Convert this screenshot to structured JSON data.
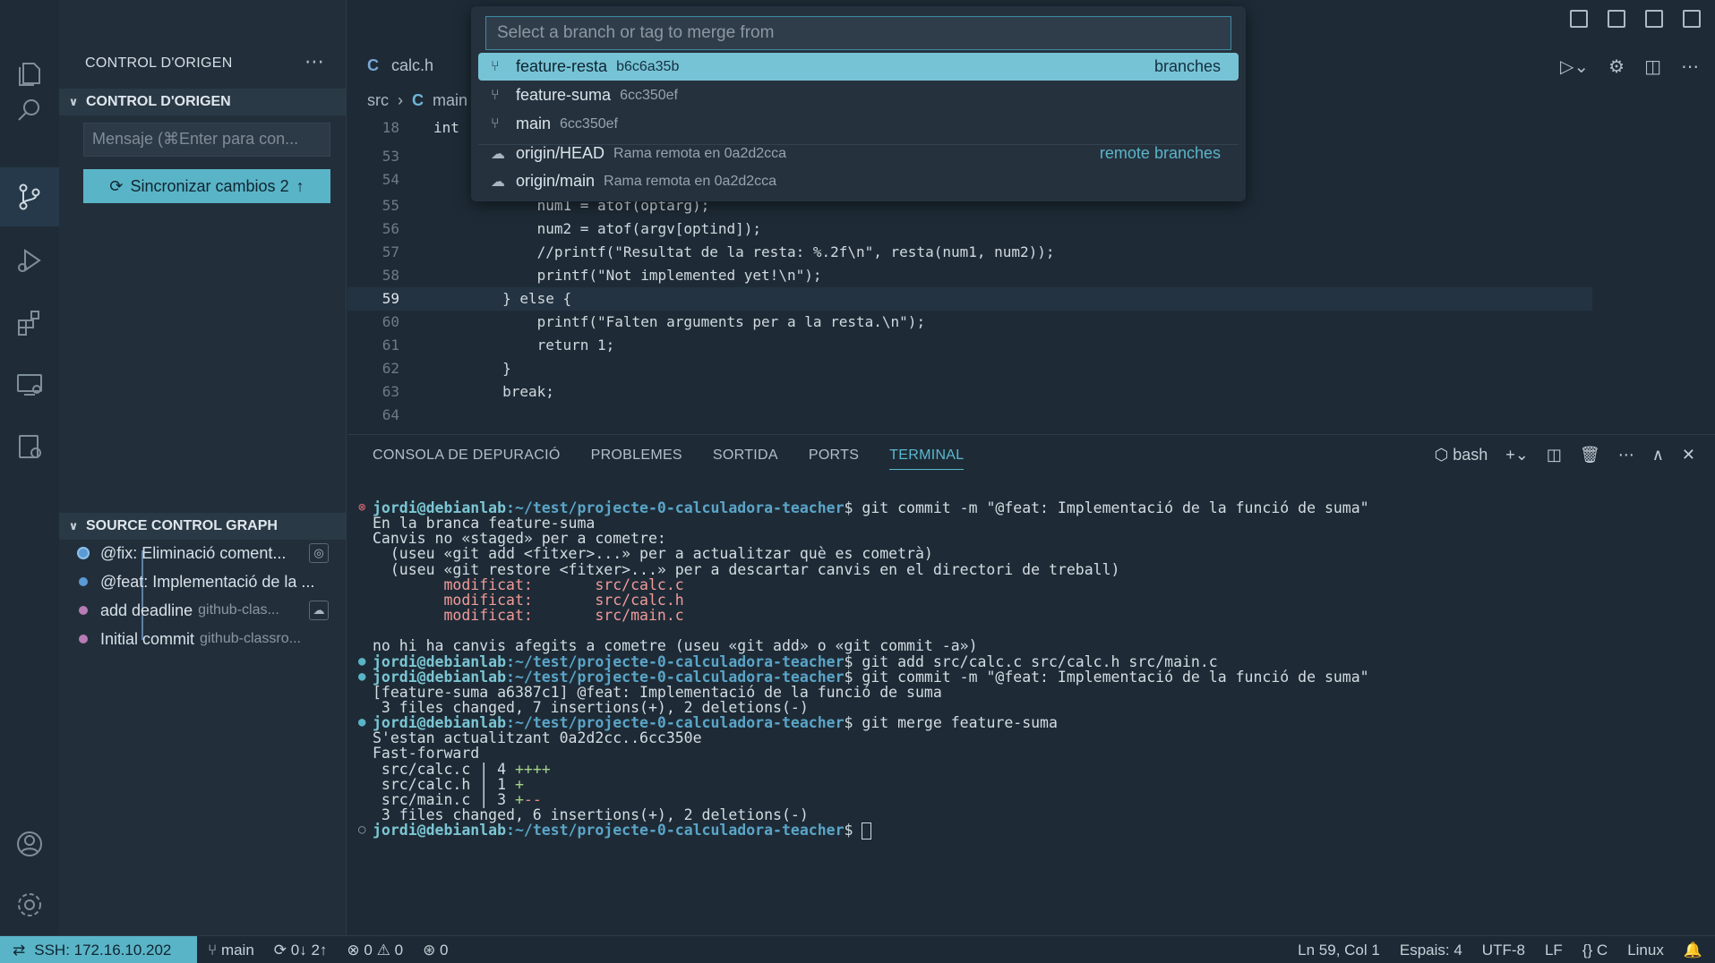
{
  "activity": [
    "explorer-icon",
    "search-icon",
    "source-control-icon",
    "run-debug-icon",
    "extensions-icon",
    "remote-explorer-icon",
    "testing-icon",
    "account-icon",
    "manage-gear-icon"
  ],
  "sidebar": {
    "title": "CONTROL D'ORIGEN",
    "section1": "CONTROL D'ORIGEN",
    "message_placeholder": "Mensaje (⌘Enter para con...",
    "sync_label": "Sincronizar cambios 2",
    "graph_title": "SOURCE CONTROL GRAPH",
    "graph": [
      {
        "label": "@fix: Eliminació coment...",
        "sub": "",
        "color": "#5a9bd6"
      },
      {
        "label": "@feat: Implementació de la ...",
        "sub": "",
        "color": "#5a9bd6"
      },
      {
        "label": "add deadline",
        "sub": "github-clas...",
        "color": "#b77bb5"
      },
      {
        "label": "Initial commit",
        "sub": "github-classro...",
        "color": "#b77bb5"
      }
    ]
  },
  "editor": {
    "tab": "calc.h",
    "tab_c": "C",
    "breadcrumb": [
      "src",
      "main"
    ],
    "lines": [
      {
        "n": "18",
        "code": "int"
      },
      {
        "n": "53",
        "code": ""
      },
      {
        "n": "54",
        "code": ""
      },
      {
        "n": "55",
        "code": "            num1 = atof(optarg);"
      },
      {
        "n": "56",
        "code": "            num2 = atof(argv[optind]);"
      },
      {
        "n": "57",
        "code": "            //printf(\"Resultat de la resta: %.2f\\n\", resta(num1, num2));"
      },
      {
        "n": "58",
        "code": "            printf(\"Not implemented yet!\\n\");"
      },
      {
        "n": "59",
        "code": "        } else {"
      },
      {
        "n": "60",
        "code": "            printf(\"Falten arguments per a la resta.\\n\");"
      },
      {
        "n": "61",
        "code": "            return 1;"
      },
      {
        "n": "62",
        "code": "        }"
      },
      {
        "n": "63",
        "code": "        break;"
      },
      {
        "n": "64",
        "code": ""
      }
    ]
  },
  "quickpick": {
    "placeholder": "Select a branch or tag to merge from",
    "items": [
      {
        "label": "feature-resta",
        "desc": "b6c6a35b",
        "group": "branches",
        "icon": "branch"
      },
      {
        "label": "feature-suma",
        "desc": "6cc350ef",
        "group": "",
        "icon": "branch"
      },
      {
        "label": "main",
        "desc": "6cc350ef",
        "group": "",
        "icon": "branch"
      },
      {
        "label": "origin/HEAD",
        "desc": "Rama remota en 0a2d2cca",
        "group": "remote branches",
        "icon": "cloud"
      },
      {
        "label": "origin/main",
        "desc": "Rama remota en 0a2d2cca",
        "group": "",
        "icon": "cloud"
      }
    ]
  },
  "panel": {
    "tabs": [
      "CONSOLA DE DEPURACIÓ",
      "PROBLEMES",
      "SORTIDA",
      "PORTS",
      "TERMINAL"
    ],
    "shell": "bash"
  },
  "terminal": {
    "user": "jordi@debianlab",
    "path": ":~/test/projecte-0-calculadora-teacher",
    "lines": [
      {
        "type": "prompt",
        "mark": "err",
        "cmd": "$ git commit -m \"@feat: Implementació de la funció de suma\""
      },
      {
        "type": "text",
        "text": "En la branca feature-suma"
      },
      {
        "type": "text",
        "text": "Canvis no «staged» per a cometre:"
      },
      {
        "type": "text",
        "text": "  (useu «git add <fitxer>...» per a actualitzar què es cometrà)"
      },
      {
        "type": "text",
        "text": "  (useu «git restore <fitxer>...» per a descartar canvis en el directori de treball)"
      },
      {
        "type": "mod",
        "a": "        modificat:",
        "b": "src/calc.c"
      },
      {
        "type": "mod",
        "a": "        modificat:",
        "b": "src/calc.h"
      },
      {
        "type": "mod",
        "a": "        modificat:",
        "b": "src/main.c"
      },
      {
        "type": "text",
        "text": ""
      },
      {
        "type": "text",
        "text": "no hi ha canvis afegits a cometre (useu «git add» o «git commit -a»)"
      },
      {
        "type": "prompt",
        "mark": "ok",
        "cmd": "$ git add src/calc.c src/calc.h src/main.c"
      },
      {
        "type": "prompt",
        "mark": "ok",
        "cmd": "$ git commit -m \"@feat: Implementació de la funció de suma\""
      },
      {
        "type": "text",
        "text": "[feature-suma a6387c1] @feat: Implementació de la funció de suma"
      },
      {
        "type": "text",
        "text": " 3 files changed, 7 insertions(+), 2 deletions(-)"
      },
      {
        "type": "prompt",
        "mark": "ok",
        "cmd": "$ git merge feature-suma"
      },
      {
        "type": "text",
        "text": "S'estan actualitzant 0a2d2cc..6cc350e"
      },
      {
        "type": "text",
        "text": "Fast-forward"
      },
      {
        "type": "diff",
        "a": " src/calc.c | 4 ",
        "b": "++++",
        "c": ""
      },
      {
        "type": "diff",
        "a": " src/calc.h | 1 ",
        "b": "+",
        "c": ""
      },
      {
        "type": "diff",
        "a": " src/main.c | 3 ",
        "b": "+",
        "c": "--"
      },
      {
        "type": "text",
        "text": " 3 files changed, 6 insertions(+), 2 deletions(-)"
      },
      {
        "type": "prompt",
        "mark": "idle",
        "cmd": "$ "
      }
    ]
  },
  "status": {
    "remote": "SSH: 172.16.10.202",
    "branch": "main",
    "sync": "0↓ 2↑",
    "errors": "0",
    "warnings": "0",
    "ports": "0",
    "position": "Ln 59, Col 1",
    "spaces": "Espais: 4",
    "encoding": "UTF-8",
    "eol": "LF",
    "language": "C",
    "os": "Linux"
  }
}
